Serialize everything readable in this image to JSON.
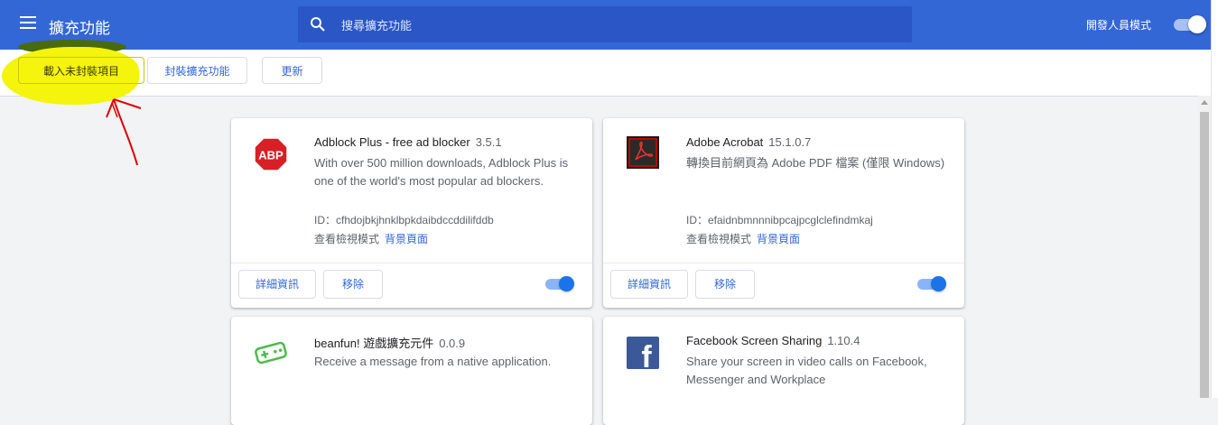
{
  "header": {
    "title": "擴充功能",
    "search_placeholder": "搜尋擴充功能",
    "developer_mode_label": "開發人員模式",
    "developer_mode_on": true,
    "color": "#3367d6"
  },
  "toolbar": {
    "load_unpacked_label": "載入未封裝項目",
    "pack_extension_label": "封裝擴充功能",
    "update_label": "更新"
  },
  "extensions": [
    {
      "name": "Adblock Plus - free ad blocker",
      "version": "3.5.1",
      "description": "With over 500 million downloads, Adblock Plus is one of the world's most popular ad blockers.",
      "id_label": "ID：cfhdojbkjhnklbpkdaibdccddilifddb",
      "inspect_label": "查看檢視模式",
      "inspect_link": "背景頁面",
      "details_label": "詳細資訊",
      "remove_label": "移除",
      "enabled": true,
      "icon": "abp-stop-sign-icon",
      "icon_text": "ABP"
    },
    {
      "name": "Adobe Acrobat",
      "version": "15.1.0.7",
      "description": "轉換目前網頁為 Adobe PDF 檔案 (僅限 Windows)",
      "id_label": "ID：efaidnbmnnnibpcajpcglclefindmkaj",
      "inspect_label": "查看檢視模式",
      "inspect_link": "背景頁面",
      "details_label": "詳細資訊",
      "remove_label": "移除",
      "enabled": true,
      "icon": "adobe-acrobat-icon"
    },
    {
      "name": "beanfun! 遊戲擴充元件",
      "version": "0.0.9",
      "description": "Receive a message from a native application.",
      "icon": "gamepad-icon"
    },
    {
      "name": "Facebook Screen Sharing",
      "version": "1.10.4",
      "description": "Share your screen in video calls on Facebook, Messenger and Workplace",
      "icon": "facebook-icon",
      "icon_text": "f"
    }
  ]
}
